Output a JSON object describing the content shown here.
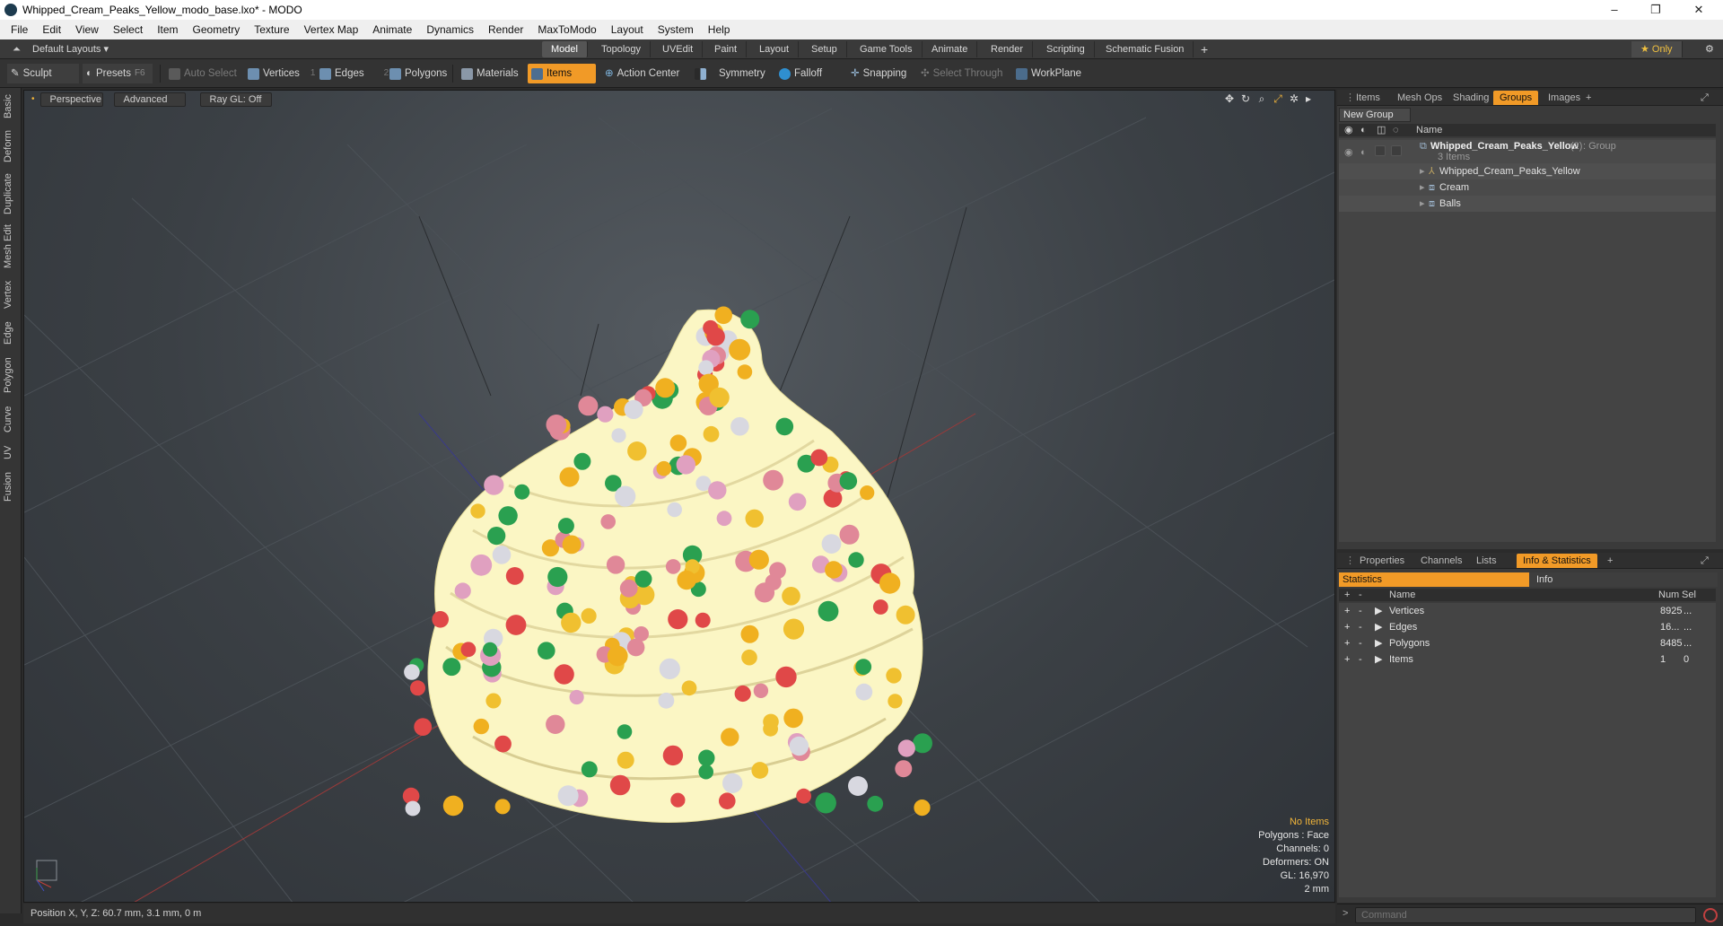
{
  "window": {
    "title": "Whipped_Cream_Peaks_Yellow_modo_base.lxo* - MODO",
    "minimize": "–",
    "maximize": "❐",
    "close": "✕"
  },
  "menu": [
    "File",
    "Edit",
    "View",
    "Select",
    "Item",
    "Geometry",
    "Texture",
    "Vertex Map",
    "Animate",
    "Dynamics",
    "Render",
    "MaxToModo",
    "Layout",
    "System",
    "Help"
  ],
  "layout_bar": {
    "default_layouts": "Default Layouts ▾",
    "tabs": [
      "Model",
      "Topology",
      "UVEdit",
      "Paint",
      "Layout",
      "Setup",
      "Game Tools",
      "Animate",
      "Render",
      "Scripting",
      "Schematic Fusion"
    ],
    "active_tab": "Model",
    "plus": "+",
    "only_label": "★  Only"
  },
  "toolbar": {
    "sculpt": "Sculpt",
    "presets": "Presets",
    "presets_key": "F6",
    "auto_select": "Auto Select",
    "vertices": "Vertices",
    "vertices_key": "1",
    "edges": "Edges",
    "edges_key": "2",
    "polygons": "Polygons",
    "materials": "Materials",
    "items": "Items",
    "action_center": "Action Center",
    "symmetry": "Symmetry",
    "falloff": "Falloff",
    "snapping": "Snapping",
    "select_through": "Select Through",
    "workplane": "WorkPlane"
  },
  "left_tabs": [
    "Basic",
    "Deform",
    "Duplicate",
    "Mesh Edit",
    "Vertex",
    "Edge",
    "Polygon",
    "Curve",
    "UV",
    "Fusion"
  ],
  "viewport": {
    "view_mode": "Perspective",
    "shading": "Advanced",
    "raygl": "Ray GL: Off",
    "hud": {
      "selection": "No Items",
      "polygons": "Polygons : Face",
      "channels": "Channels: 0",
      "deformers": "Deformers: ON",
      "gl": "GL: 16,970",
      "scale": "2 mm"
    }
  },
  "status_bar": {
    "position": "Position X, Y, Z:  60.7 mm, 3.1 mm, 0 m"
  },
  "groups_panel": {
    "tabs": [
      "Items",
      "Mesh Ops",
      "Shading",
      "Groups",
      "Images"
    ],
    "active_tab": "Groups",
    "new_group": "New Group",
    "col_name": "Name",
    "group": {
      "name": "Whipped_Cream_Peaks_Yellow",
      "count": "(2)",
      "type": ": Group",
      "sub": "3 Items"
    },
    "children": [
      "Whipped_Cream_Peaks_Yellow",
      "Cream",
      "Balls"
    ]
  },
  "info_panel": {
    "tabs": [
      "Properties",
      "Channels",
      "Lists",
      "Info & Statistics"
    ],
    "active_tab": "Info & Statistics",
    "sub_tabs": [
      "Statistics",
      "Info"
    ],
    "columns": {
      "name": "Name",
      "num": "Num",
      "sel": "Sel"
    },
    "rows": [
      {
        "name": "Vertices",
        "num": "8925",
        "sel": "..."
      },
      {
        "name": "Edges",
        "num": "16...",
        "sel": "..."
      },
      {
        "name": "Polygons",
        "num": "8485",
        "sel": "..."
      },
      {
        "name": "Items",
        "num": "1",
        "sel": "0"
      }
    ]
  },
  "command": {
    "placeholder": "Command",
    "prompt": ">"
  },
  "colors": {
    "accent": "#f19a27",
    "cream": "#fbf6c4",
    "hud_highlight": "#f0b43a"
  }
}
